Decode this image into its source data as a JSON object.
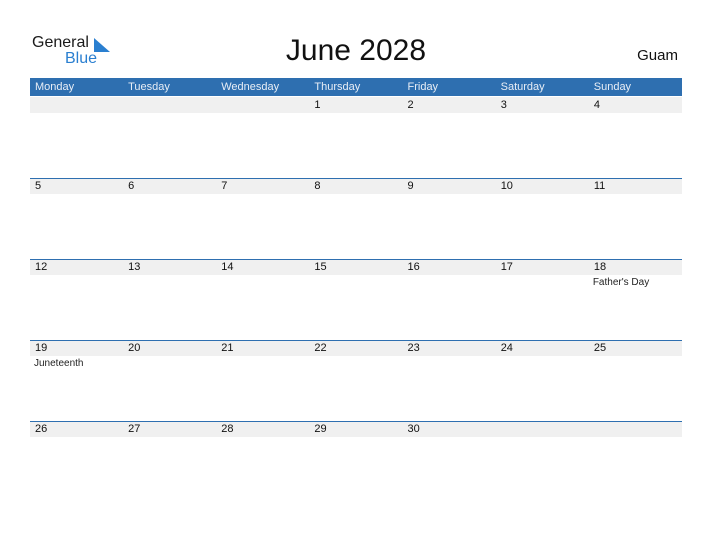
{
  "logo": {
    "line1": "General",
    "line2": "Blue"
  },
  "title": "June 2028",
  "region": "Guam",
  "colors": {
    "header_bg": "#2e6fb0",
    "accent": "#2a7fd0",
    "strip_bg": "#f0f0f0"
  },
  "weekdays": [
    "Monday",
    "Tuesday",
    "Wednesday",
    "Thursday",
    "Friday",
    "Saturday",
    "Sunday"
  ],
  "weeks": [
    [
      {
        "day": ""
      },
      {
        "day": ""
      },
      {
        "day": ""
      },
      {
        "day": "1"
      },
      {
        "day": "2"
      },
      {
        "day": "3"
      },
      {
        "day": "4"
      }
    ],
    [
      {
        "day": "5"
      },
      {
        "day": "6"
      },
      {
        "day": "7"
      },
      {
        "day": "8"
      },
      {
        "day": "9"
      },
      {
        "day": "10"
      },
      {
        "day": "11"
      }
    ],
    [
      {
        "day": "12"
      },
      {
        "day": "13"
      },
      {
        "day": "14"
      },
      {
        "day": "15"
      },
      {
        "day": "16"
      },
      {
        "day": "17"
      },
      {
        "day": "18",
        "holiday": "Father's Day"
      }
    ],
    [
      {
        "day": "19",
        "holiday": "Juneteenth"
      },
      {
        "day": "20"
      },
      {
        "day": "21"
      },
      {
        "day": "22"
      },
      {
        "day": "23"
      },
      {
        "day": "24"
      },
      {
        "day": "25"
      }
    ],
    [
      {
        "day": "26"
      },
      {
        "day": "27"
      },
      {
        "day": "28"
      },
      {
        "day": "29"
      },
      {
        "day": "30"
      },
      {
        "day": ""
      },
      {
        "day": ""
      }
    ]
  ]
}
